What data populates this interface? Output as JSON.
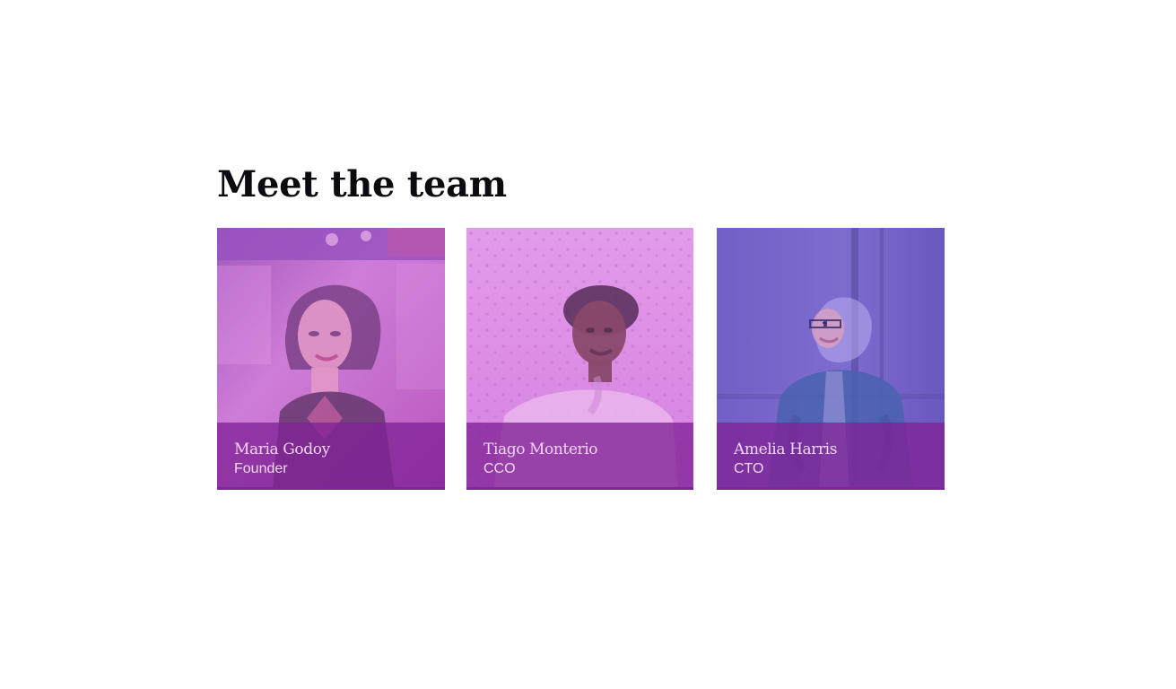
{
  "section": {
    "title": "Meet the team"
  },
  "team": [
    {
      "name": "Maria Godoy",
      "role": "Founder"
    },
    {
      "name": "Tiago Monterio",
      "role": "CCO"
    },
    {
      "name": "Amelia Harris",
      "role": "CTO"
    }
  ],
  "colors": {
    "overlay": "#7F2296",
    "card1_tint": "#C86ACB",
    "card2_tint": "#D98AE0",
    "card3_tint": "#7D64C7"
  }
}
